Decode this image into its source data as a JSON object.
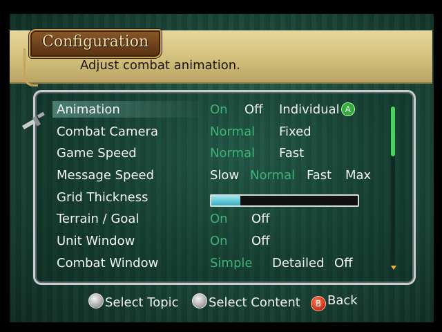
{
  "header": {
    "title": "Configuration",
    "description": "Adjust combat animation."
  },
  "settings": [
    {
      "label": "Animation",
      "options": [
        "On",
        "Off",
        "Individual"
      ],
      "selected": "On",
      "has_a_badge": true
    },
    {
      "label": "Combat Camera",
      "options": [
        "Normal",
        "Fixed"
      ],
      "selected": "Normal"
    },
    {
      "label": "Game Speed",
      "options": [
        "Normal",
        "Fast"
      ],
      "selected": "Normal"
    },
    {
      "label": "Message Speed",
      "options": [
        "Slow",
        "Normal",
        "Fast",
        "Max"
      ],
      "selected": "Normal"
    },
    {
      "label": "Grid Thickness",
      "gauge_level": 0.2
    },
    {
      "label": "Terrain / Goal",
      "options": [
        "On",
        "Off"
      ],
      "selected": "On"
    },
    {
      "label": "Unit Window",
      "options": [
        "On",
        "Off"
      ],
      "selected": "On"
    },
    {
      "label": "Combat Window",
      "options": [
        "Simple",
        "Detailed",
        "Off"
      ],
      "selected": "Simple"
    }
  ],
  "a_badge": "A",
  "footer": {
    "select_topic": "Select Topic",
    "select_content": "Select Content",
    "back": "Back",
    "b_badge": "B"
  },
  "colors": {
    "active_option": "#3fb27a",
    "inactive_option": "#f4f4f4",
    "gauge_fill": "#36aec0",
    "scroll_thumb": "#4ad25d"
  },
  "icons": [
    "sword-icon",
    "a-button-icon",
    "stick-icon",
    "b-button-icon",
    "scroll-down-arrow-icon"
  ]
}
